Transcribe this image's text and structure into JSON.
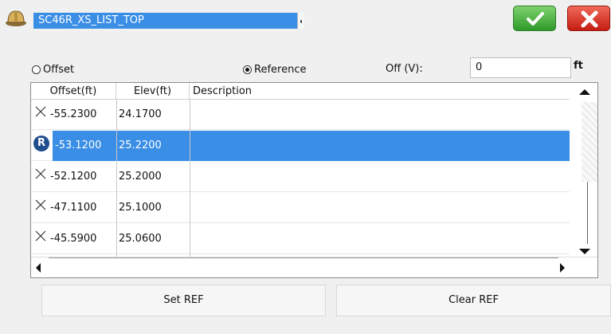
{
  "header": {
    "title": "SC46R_XS_LIST_TOP",
    "ok_icon": "check-icon",
    "cancel_icon": "close-icon",
    "colors": {
      "accent": "#3a8ee6",
      "ok": "#2f9a2a",
      "cancel": "#c51d12"
    }
  },
  "options": {
    "offset_label": "Offset",
    "reference_label": "Reference",
    "selected": "Reference",
    "offv_label": "Off (V):",
    "offv_value": "0",
    "unit": "ft"
  },
  "table": {
    "columns": [
      "Offset(ft)",
      "Elev(ft)",
      "Description"
    ],
    "rows": [
      {
        "icon": "x-mark-icon",
        "offset": "-55.2300",
        "elev": "24.1700",
        "description": ""
      },
      {
        "icon": "reference-r-icon",
        "offset": "-53.1200",
        "elev": "25.2200",
        "description": "",
        "selected": true
      },
      {
        "icon": "x-mark-icon",
        "offset": "-52.1200",
        "elev": "25.2000",
        "description": ""
      },
      {
        "icon": "x-mark-icon",
        "offset": "-47.1100",
        "elev": "25.1000",
        "description": ""
      },
      {
        "icon": "x-mark-icon",
        "offset": "-45.5900",
        "elev": "25.0600",
        "description": ""
      }
    ],
    "ref_glyph": "R"
  },
  "buttons": {
    "set_ref": "Set REF",
    "clear_ref": "Clear REF"
  }
}
